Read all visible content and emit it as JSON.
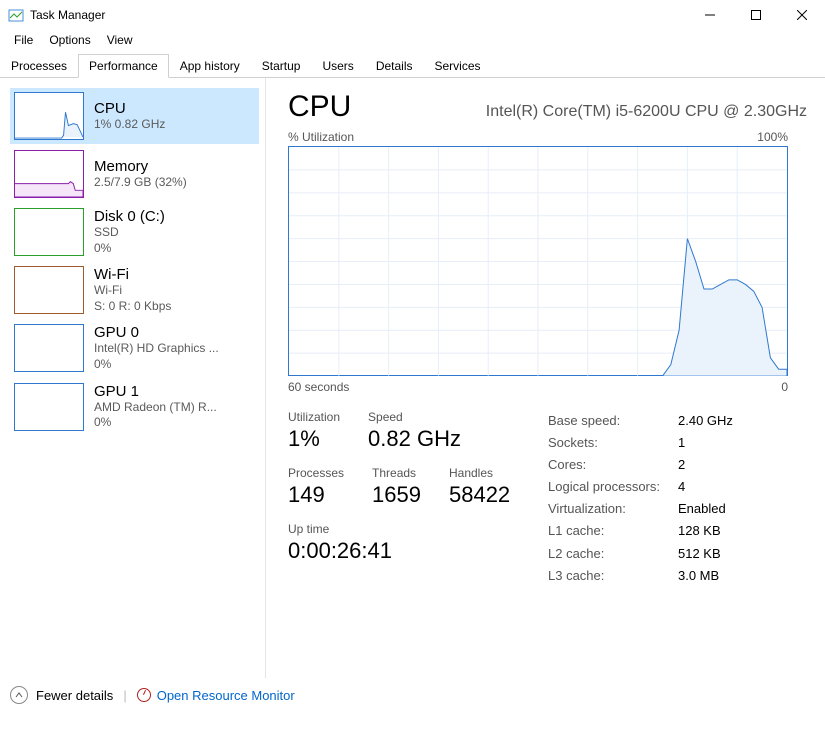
{
  "window": {
    "title": "Task Manager"
  },
  "menu": {
    "file": "File",
    "options": "Options",
    "view": "View"
  },
  "tabs": {
    "processes": "Processes",
    "performance": "Performance",
    "app_history": "App history",
    "startup": "Startup",
    "users": "Users",
    "details": "Details",
    "services": "Services"
  },
  "sidebar": {
    "cpu": {
      "title": "CPU",
      "sub": "1% 0.82 GHz"
    },
    "memory": {
      "title": "Memory",
      "sub": "2.5/7.9 GB (32%)"
    },
    "disk": {
      "title": "Disk 0 (C:)",
      "sub1": "SSD",
      "sub2": "0%"
    },
    "wifi": {
      "title": "Wi-Fi",
      "sub1": "Wi-Fi",
      "sub2": "S: 0 R: 0 Kbps"
    },
    "gpu0": {
      "title": "GPU 0",
      "sub1": "Intel(R) HD Graphics ...",
      "sub2": "0%"
    },
    "gpu1": {
      "title": "GPU 1",
      "sub1": "AMD Radeon (TM) R...",
      "sub2": "0%"
    }
  },
  "detail": {
    "title": "CPU",
    "subtitle": "Intel(R) Core(TM) i5-6200U CPU @ 2.30GHz",
    "chart_top_left": "% Utilization",
    "chart_top_right": "100%",
    "chart_bottom_left": "60 seconds",
    "chart_bottom_right": "0",
    "stats": {
      "utilization_label": "Utilization",
      "utilization": "1%",
      "speed_label": "Speed",
      "speed": "0.82 GHz",
      "processes_label": "Processes",
      "processes": "149",
      "threads_label": "Threads",
      "threads": "1659",
      "handles_label": "Handles",
      "handles": "58422",
      "uptime_label": "Up time",
      "uptime": "0:00:26:41"
    },
    "specs": {
      "base_speed_label": "Base speed:",
      "base_speed": "2.40 GHz",
      "sockets_label": "Sockets:",
      "sockets": "1",
      "cores_label": "Cores:",
      "cores": "2",
      "lp_label": "Logical processors:",
      "lp": "4",
      "virt_label": "Virtualization:",
      "virt": "Enabled",
      "l1_label": "L1 cache:",
      "l1": "128 KB",
      "l2_label": "L2 cache:",
      "l2": "512 KB",
      "l3_label": "L3 cache:",
      "l3": "3.0 MB"
    }
  },
  "footer": {
    "fewer": "Fewer details",
    "orm": "Open Resource Monitor"
  },
  "chart_data": {
    "type": "area",
    "title": "% Utilization",
    "xlabel": "seconds",
    "ylabel": "% Utilization",
    "xlim": [
      60,
      0
    ],
    "ylim": [
      0,
      100
    ],
    "x": [
      60,
      15,
      14,
      13,
      12,
      11,
      10,
      9,
      8,
      7,
      6,
      5,
      4,
      3,
      2,
      1,
      0
    ],
    "values": [
      0,
      0,
      5,
      20,
      60,
      50,
      38,
      38,
      40,
      42,
      42,
      40,
      37,
      30,
      8,
      3,
      3
    ]
  }
}
